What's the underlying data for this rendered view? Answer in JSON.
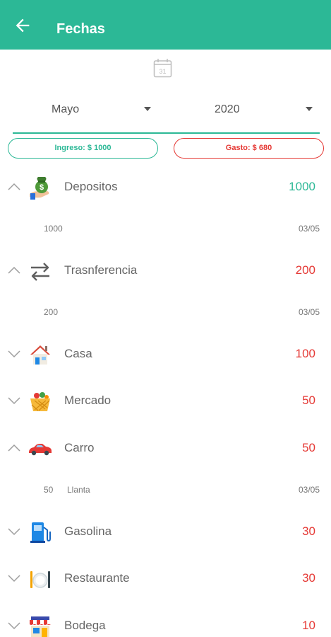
{
  "header": {
    "title": "Fechas"
  },
  "calendar": {
    "day": "31"
  },
  "filters": {
    "month": "Mayo",
    "year": "2020"
  },
  "summary": {
    "income": "Ingreso: $ 1000",
    "expense": "Gasto: $ 680"
  },
  "colors": {
    "accent": "#2cb896",
    "expense": "#e53935"
  },
  "categories": [
    {
      "name": "Depositos",
      "total": "1000",
      "icon": "money-bag-icon",
      "expanded": true,
      "entries": [
        {
          "amount": "1000",
          "note": "",
          "date": "03/05"
        }
      ]
    },
    {
      "name": "Trasnferencia",
      "total": "200",
      "icon": "transfer-arrows-icon",
      "expanded": true,
      "entries": [
        {
          "amount": "200",
          "note": "",
          "date": "03/05"
        }
      ]
    },
    {
      "name": "Casa",
      "total": "100",
      "icon": "house-icon",
      "expanded": false
    },
    {
      "name": "Mercado",
      "total": "50",
      "icon": "basket-icon",
      "expanded": false
    },
    {
      "name": "Carro",
      "total": "50",
      "icon": "car-icon",
      "expanded": true,
      "entries": [
        {
          "amount": "50",
          "note": "Llanta",
          "date": "03/05"
        }
      ]
    },
    {
      "name": "Gasolina",
      "total": "30",
      "icon": "gas-pump-icon",
      "expanded": false
    },
    {
      "name": "Restaurante",
      "total": "30",
      "icon": "plate-cutlery-icon",
      "expanded": false
    },
    {
      "name": "Bodega",
      "total": "10",
      "icon": "store-icon",
      "expanded": false
    }
  ]
}
